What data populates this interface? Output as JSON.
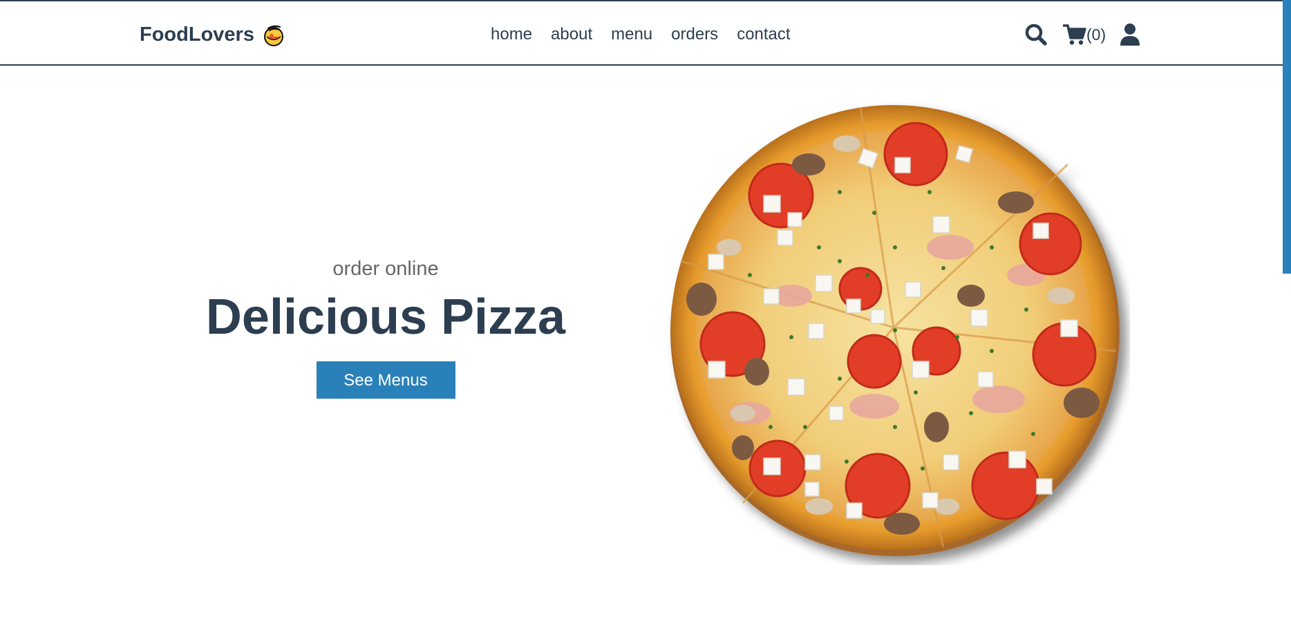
{
  "header": {
    "logo_text": "FoodLovers",
    "logo_icon": "noodle-bowl-icon",
    "nav": [
      {
        "label": "home"
      },
      {
        "label": "about"
      },
      {
        "label": "menu"
      },
      {
        "label": "orders"
      },
      {
        "label": "contact"
      }
    ],
    "icons": {
      "search": "search-icon",
      "cart": "cart-icon",
      "user": "user-icon"
    },
    "cart_count": "(0)"
  },
  "hero": {
    "subtitle": "order online",
    "title": "Delicious Pizza",
    "button_label": "See Menus",
    "image": "pizza-image"
  },
  "colors": {
    "primary": "#2c3e50",
    "accent": "#2a80b9",
    "muted": "#666666",
    "background": "#ffffff"
  }
}
